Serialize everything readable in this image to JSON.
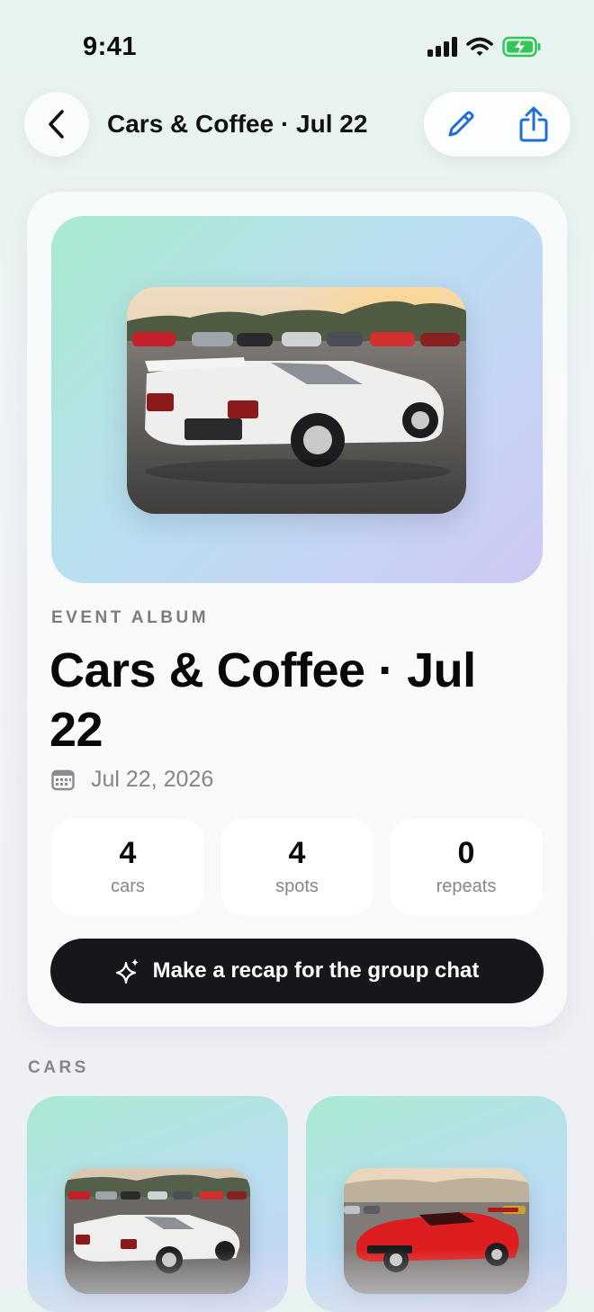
{
  "status_bar": {
    "time": "9:41"
  },
  "nav": {
    "title": "Cars & Coffee · Jul 22"
  },
  "album": {
    "eyebrow": "EVENT ALBUM",
    "title": "Cars & Coffee · Jul 22",
    "date": "Jul 22, 2026"
  },
  "stats": [
    {
      "value": "4",
      "label": "cars"
    },
    {
      "value": "4",
      "label": "spots"
    },
    {
      "value": "0",
      "label": "repeats"
    }
  ],
  "recap_button": {
    "label": "Make a recap for the group chat"
  },
  "cars_section": {
    "label": "CARS"
  },
  "colors": {
    "accent": "#1f6fd6",
    "battery": "#33c759",
    "dark_button": "#17171b"
  }
}
